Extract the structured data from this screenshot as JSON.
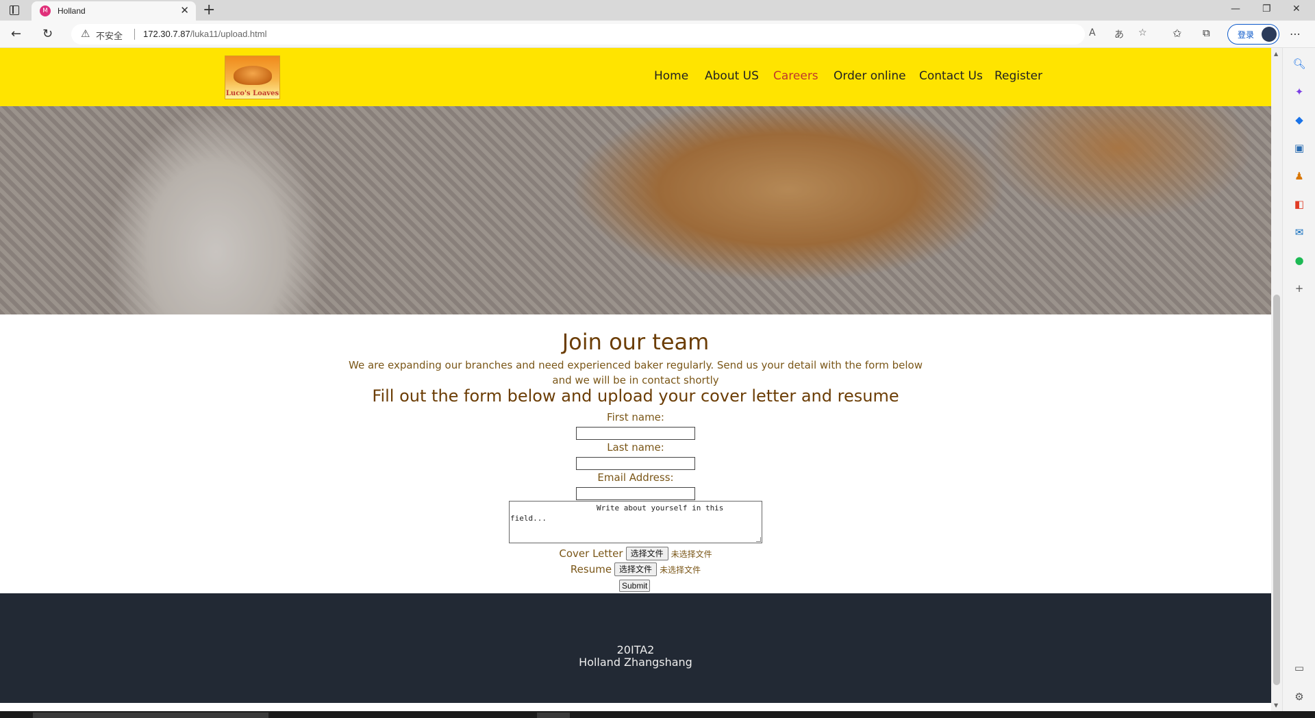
{
  "browser": {
    "tab_title": "Holland",
    "favicon_text": "M",
    "new_tab_icon": "plus-icon",
    "security_label": "不安全",
    "url_host": "172.30.7.87",
    "url_path": "/luka11/upload.html",
    "login_label": "登录"
  },
  "site": {
    "logo_text": "Luco's Loaves",
    "nav": [
      {
        "label": "Home"
      },
      {
        "label": "About US"
      },
      {
        "label": "Careers"
      },
      {
        "label": "Order online"
      },
      {
        "label": "Contact Us"
      },
      {
        "label": "Register"
      }
    ],
    "active_nav": "Careers",
    "colors": {
      "navbar": "#ffe400",
      "active": "#c0392b",
      "heading": "#6b3d05",
      "footer": "#222934"
    }
  },
  "main": {
    "title": "Join our team",
    "intro_line1": "We are expanding our branches and need experienced baker regularly. Send us your detail with the form below",
    "intro_line2": "and we will be in contact shortly",
    "form_heading": "Fill out the form below and upload your cover letter and resume"
  },
  "form": {
    "first_name_label": "First name:",
    "last_name_label": "Last name:",
    "email_label": "Email Address:",
    "about_text": "Write about yourself in this field...",
    "cover_letter_label": "Cover Letter",
    "resume_label": "Resume",
    "choose_file_label": "选择文件",
    "no_file_label": "未选择文件",
    "submit_label": "Submit"
  },
  "footer": {
    "line1": "20ITA2",
    "line2": "Holland Zhangshang"
  }
}
